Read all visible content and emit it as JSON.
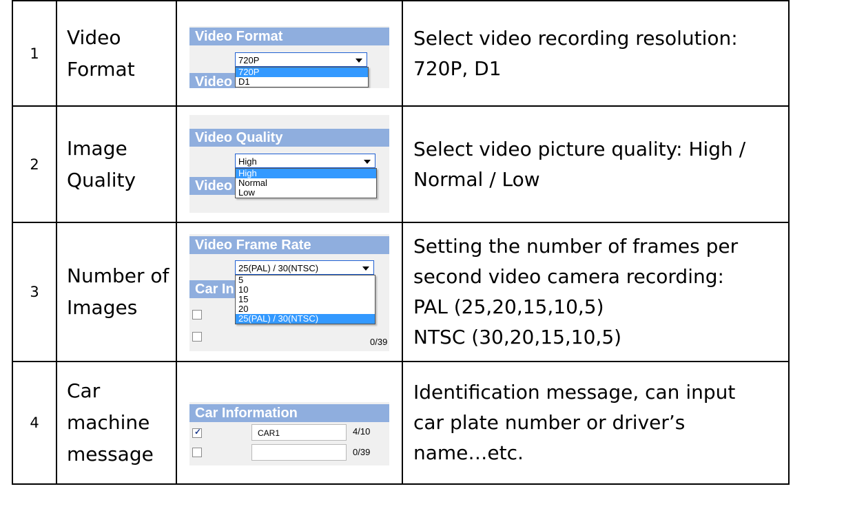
{
  "rows": [
    {
      "num": "1",
      "item": "Video Format",
      "desc": [
        "Select video recording resolution:",
        "720P, D1"
      ],
      "shot": {
        "heading": "Video Format",
        "heading2": "Video",
        "selected": "720P",
        "options": [
          "720P",
          "D1"
        ],
        "highlight_index": 0
      }
    },
    {
      "num": "2",
      "item": "Image Quality",
      "desc": [
        "Select video picture quality: High /",
        "Normal / Low"
      ],
      "shot": {
        "heading": "Video Quality",
        "heading2": "Video",
        "selected": "High",
        "options": [
          "High",
          "Normal",
          "Low"
        ],
        "highlight_index": 0
      }
    },
    {
      "num": "3",
      "item_lines": [
        "Number of",
        "Images"
      ],
      "desc": [
        "Setting the number of frames per",
        "second video camera recording:",
        "PAL (25,20,15,10,5)",
        "NTSC (30,20,15,10,5)"
      ],
      "shot": {
        "heading": "Video Frame Rate",
        "heading2": "Car In",
        "selected": "25(PAL) / 30(NTSC)",
        "options": [
          "5",
          "10",
          "15",
          "20",
          "25(PAL) / 30(NTSC)"
        ],
        "highlight_index": 4,
        "side_count": "0/39"
      }
    },
    {
      "num": "4",
      "item_lines": [
        "Car machine",
        "message"
      ],
      "desc": [
        "Identification message, can input",
        "car plate number or driver’s",
        "name…etc."
      ],
      "shot": {
        "heading": "Car Information",
        "field1_value": "CAR1",
        "field1_count": "4/10",
        "field2_value": "",
        "field2_count": "0/39",
        "field1_checked": true,
        "field2_checked": false
      }
    }
  ]
}
